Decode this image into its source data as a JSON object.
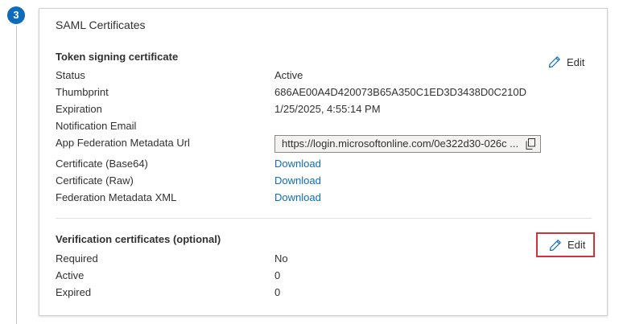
{
  "step": {
    "number": "3"
  },
  "card": {
    "title": "SAML Certificates"
  },
  "token_signing": {
    "title": "Token signing certificate",
    "edit_label": "Edit",
    "rows": [
      {
        "label": "Status",
        "value": "Active"
      },
      {
        "label": "Thumbprint",
        "value": "686AE00A4D420073B65A350C1ED3D3438D0C210D"
      },
      {
        "label": "Expiration",
        "value": "1/25/2025, 4:55:14 PM"
      },
      {
        "label": "Notification Email",
        "value": ""
      },
      {
        "label": "App Federation Metadata Url",
        "value": "https://login.microsoftonline.com/0e322d30-026c ..."
      },
      {
        "label": "Certificate (Base64)",
        "value": "Download"
      },
      {
        "label": "Certificate (Raw)",
        "value": "Download"
      },
      {
        "label": "Federation Metadata XML",
        "value": "Download"
      }
    ]
  },
  "verification": {
    "title": "Verification certificates (optional)",
    "edit_label": "Edit",
    "rows": [
      {
        "label": "Required",
        "value": "No"
      },
      {
        "label": "Active",
        "value": "0"
      },
      {
        "label": "Expired",
        "value": "0"
      }
    ]
  },
  "colors": {
    "accent": "#0f6cbd",
    "link": "#0f6cbd",
    "highlight": "#d13438",
    "text": "#323130"
  },
  "icons": {
    "edit": "pencil-icon",
    "copy": "copy-icon"
  }
}
